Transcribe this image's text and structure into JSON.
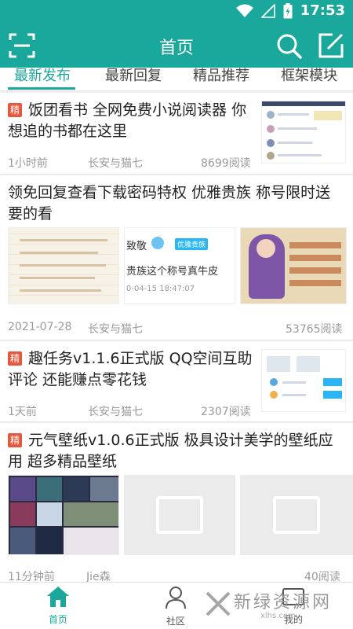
{
  "status_bar": {
    "time": "17:53"
  },
  "app_bar": {
    "title": "首页"
  },
  "tabs": [
    {
      "label": "最新发布"
    },
    {
      "label": "最新回复"
    },
    {
      "label": "精品推荐"
    },
    {
      "label": "框架模块"
    }
  ],
  "posts": [
    {
      "badge": "精",
      "title": "饭团看书 全网免费小说阅读器 你想追的书都在这里",
      "time": "1小时前",
      "author": "长安与猫七",
      "views": "8699阅读"
    },
    {
      "title": "领免回复查看下载密码特权 优雅贵族 称号限时送 要的看",
      "time": "2021-07-28",
      "author": "长安与猫七",
      "views": "53765阅读",
      "image_text": {
        "username": "致敬",
        "tag": "优雅贵族",
        "comment": "贵族这个称号真牛皮",
        "date": "0-04-15 18:47:07"
      }
    },
    {
      "badge": "精",
      "title": "趣任务v1.1.6正式版 QQ空间互助 评论 还能赚点零花钱",
      "time": "1天前",
      "author": "长安与猫七",
      "views": "2307阅读"
    },
    {
      "badge": "精",
      "title": "元气壁纸v1.0.6正式版 极具设计美学的壁纸应用 超多精品壁纸",
      "time": "11分钟前",
      "author": "Jie森",
      "views": "40阅读"
    }
  ],
  "bottom_nav": [
    {
      "label": "首页",
      "icon": "home-icon"
    },
    {
      "label": "社区",
      "icon": "person-icon"
    },
    {
      "label": "我的",
      "icon": "profile-icon"
    }
  ],
  "watermark": {
    "title": "新绿资源网",
    "sub": "xlhs.com"
  },
  "colors": {
    "accent": "#1aa79c",
    "badge": "#e5583f"
  }
}
